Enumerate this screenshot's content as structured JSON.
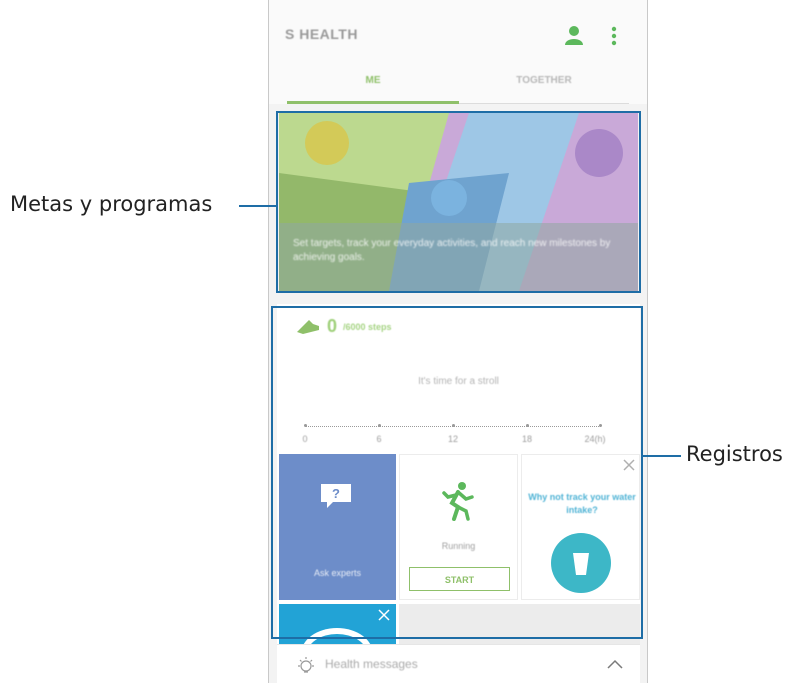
{
  "callouts": {
    "goals_label": "Metas y programas",
    "records_label": "Registros"
  },
  "app": {
    "title": "S HEALTH",
    "tabs": [
      {
        "label": "ME",
        "selected": true
      },
      {
        "label": "TOGETHER",
        "selected": false
      }
    ],
    "icons": [
      "person-icon",
      "more-vert-icon"
    ]
  },
  "banner": {
    "text": "Set targets, track your everyday activities, and reach new milestones by achieving goals."
  },
  "steps": {
    "value": "0",
    "unit": "/6000 steps",
    "message": "It's time for a stroll",
    "timeline_ticks": [
      "0",
      "6",
      "12",
      "18",
      "24(h)"
    ]
  },
  "tiles": {
    "ask_label": "Ask experts",
    "run_label": "Running",
    "start_label": "START",
    "water_text": "Why not track your water intake?"
  },
  "messages": {
    "label": "Health messages"
  },
  "colors": {
    "accent_green": "#8fc06a",
    "ask_tile": "#6d8dc9",
    "water_button": "#3db7c7",
    "callout_line": "#1e6da6"
  }
}
